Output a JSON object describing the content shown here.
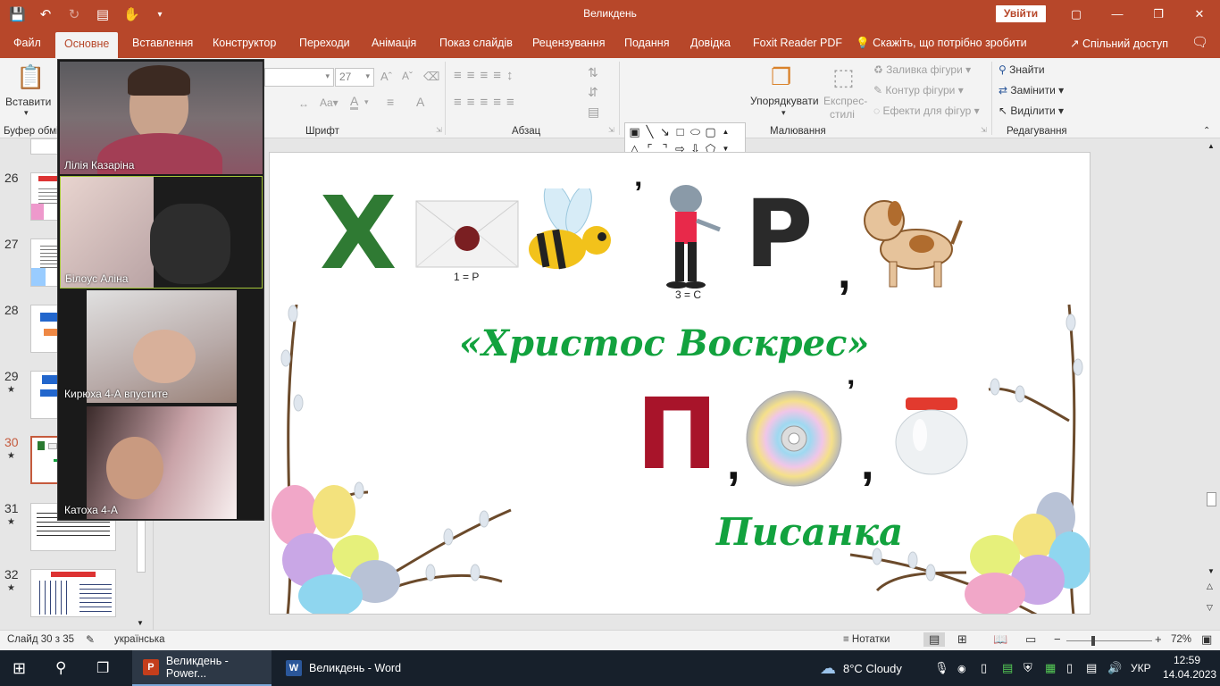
{
  "window": {
    "title": "Великдень",
    "signin_label": "Увійти"
  },
  "tabs": [
    {
      "label": "Файл"
    },
    {
      "label": "Основне"
    },
    {
      "label": "Вставлення"
    },
    {
      "label": "Конструктор"
    },
    {
      "label": "Переходи"
    },
    {
      "label": "Анімація"
    },
    {
      "label": "Показ слайдів"
    },
    {
      "label": "Рецензування"
    },
    {
      "label": "Подання"
    },
    {
      "label": "Довідка"
    },
    {
      "label": "Foxit Reader PDF"
    }
  ],
  "tell_me": "Скажіть, що потрібно зробити",
  "share": "Спільний доступ",
  "ribbon": {
    "paste": "Вставити",
    "clipboard_group": "Буфер обмі",
    "font_size": "27",
    "font_group": "Шрифт",
    "paragraph_group": "Абзац",
    "arrange": "Упорядкувати",
    "quick_styles_1": "Експрес-",
    "quick_styles_2": "стилі",
    "shape_fill": "Заливка фігури",
    "shape_outline": "Контур фігури",
    "shape_effects": "Ефекти для фігур",
    "drawing_group": "Малювання",
    "find": "Знайти",
    "replace": "Замінити",
    "select": "Виділити",
    "editing_group": "Редагування"
  },
  "thumbnails": [
    {
      "num": "26",
      "star": ""
    },
    {
      "num": "27",
      "star": ""
    },
    {
      "num": "28",
      "star": ""
    },
    {
      "num": "29",
      "star": "★"
    },
    {
      "num": "30",
      "star": "★"
    },
    {
      "num": "31",
      "star": "★"
    },
    {
      "num": "32",
      "star": "★"
    }
  ],
  "participants": [
    {
      "name": "Лілія Казаріна"
    },
    {
      "name": "Білоус Аліна"
    },
    {
      "name": "Кирюха 4-А впустите"
    },
    {
      "name": "Катоха 4-А"
    }
  ],
  "slide": {
    "label_1": "1 = Р",
    "label_3": "3 = С",
    "letter_x": "Х",
    "letter_r": "Р",
    "letter_p": "П",
    "comma": ",",
    "apostrophe": "’",
    "phrase_1": "«Христос Воскрес»",
    "phrase_2": "Писанка"
  },
  "status": {
    "slide_counter": "Слайд 30 з 35",
    "language": "українська",
    "notes": "Нотатки",
    "zoom": "72%"
  },
  "taskbar": {
    "ppt_label": "Великдень - Power...",
    "word_label": "Великдень - Word",
    "weather": "8°C  Cloudy",
    "lang": "УКР",
    "time": "12:59",
    "date": "14.04.2023"
  },
  "colors": {
    "accent": "#b7472a",
    "title_green": "#12a23e"
  }
}
